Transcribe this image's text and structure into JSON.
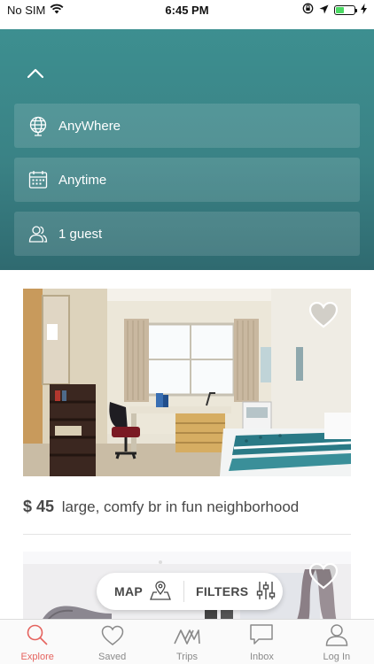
{
  "status_bar": {
    "carrier": "No SIM",
    "time": "6:45 PM",
    "battery_level": 0.45
  },
  "search": {
    "where": {
      "label": "AnyWhere",
      "icon": "globe-icon"
    },
    "when": {
      "label": "Anytime",
      "icon": "calendar-icon"
    },
    "guests": {
      "label": "1 guest",
      "icon": "people-icon"
    },
    "header_color": "#3b8587"
  },
  "listings": [
    {
      "price": "$ 45",
      "title": "large, comfy br in fun neighborhood",
      "saved": false
    },
    {
      "price": "",
      "title": "",
      "saved": false
    }
  ],
  "float_bar": {
    "map_label": "MAP",
    "filters_label": "FILTERS"
  },
  "tabs": [
    {
      "label": "Explore",
      "icon": "search-icon",
      "active": true
    },
    {
      "label": "Saved",
      "icon": "heart-icon",
      "active": false
    },
    {
      "label": "Trips",
      "icon": "trips-logo-icon",
      "active": false
    },
    {
      "label": "Inbox",
      "icon": "chat-bubble-icon",
      "active": false
    },
    {
      "label": "Log In",
      "icon": "user-icon",
      "active": false
    }
  ],
  "accent_color": "#e5635e"
}
